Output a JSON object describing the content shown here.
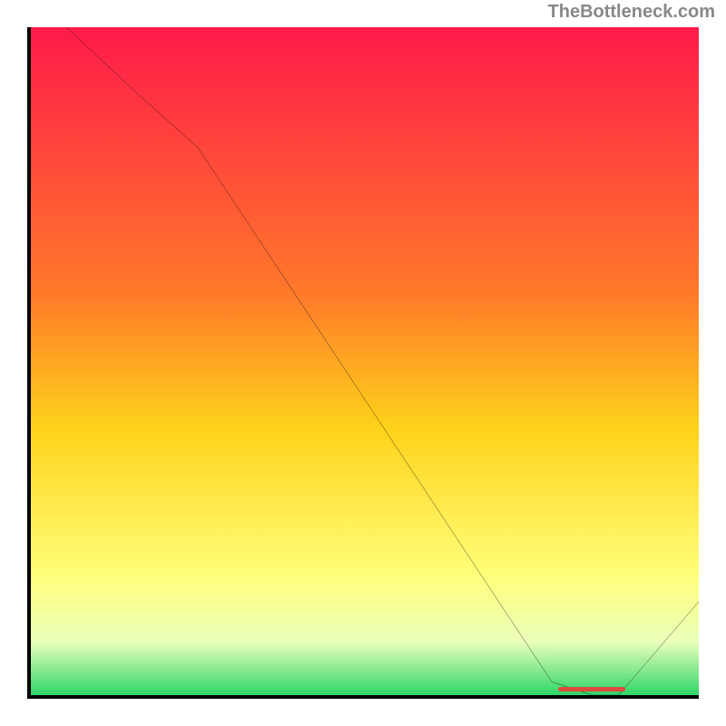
{
  "watermark": "TheBottleneck.com",
  "chart_data": {
    "type": "line",
    "title": "",
    "xlabel": "",
    "ylabel": "",
    "xlim": [
      0,
      100
    ],
    "ylim": [
      0,
      100
    ],
    "x": [
      0,
      16,
      25,
      78,
      84,
      88,
      100
    ],
    "values": [
      105,
      90,
      82,
      2,
      0,
      0,
      14
    ],
    "gradient_stops": [
      {
        "offset": 0,
        "color": "#ff1a4a"
      },
      {
        "offset": 40,
        "color": "#ff7a2a"
      },
      {
        "offset": 60,
        "color": "#ffd21a"
      },
      {
        "offset": 82,
        "color": "#ffff7a"
      },
      {
        "offset": 92,
        "color": "#eaffba"
      },
      {
        "offset": 100,
        "color": "#2fd66a"
      }
    ],
    "marker": {
      "x_start": 79,
      "x_end": 89,
      "y": 0.5,
      "color": "#e04a3a"
    }
  }
}
